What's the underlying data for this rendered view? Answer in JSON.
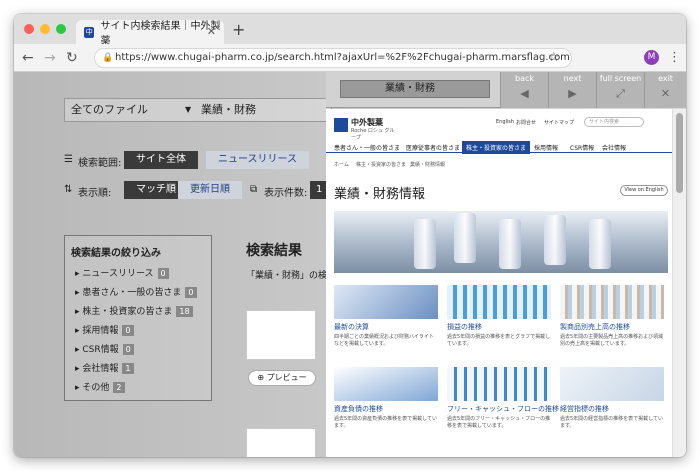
{
  "browser": {
    "tab_title": "サイト内検索結果｜中外製薬",
    "tab_favicon": "中",
    "new_tab": "+",
    "url": "https://www.chugai-pharm.co.jp/search.html?ajaxUrl=%2F%2Fchugai-pharm.marsflag.com%2Fja_all%2Fx_...",
    "profile_initial": "M"
  },
  "search_page": {
    "file_select": "全てのファイル",
    "query": "業績・財務",
    "scope_label": "検索範囲:",
    "scope_options": [
      "サイト全体",
      "ニュースリリース"
    ],
    "order_label": "表示順:",
    "order_options": [
      "マッチ順",
      "更新日順"
    ],
    "count_label": "表示件数:",
    "count_value": "1",
    "filter_title": "検索結果の絞り込み",
    "filters": [
      {
        "label": "ニュースリリース",
        "count": "0"
      },
      {
        "label": "患者さん・一般の皆さま",
        "count": "0"
      },
      {
        "label": "株主・投資家の皆さま",
        "count": "18"
      },
      {
        "label": "採用情報",
        "count": "0"
      },
      {
        "label": "CSR情報",
        "count": "0"
      },
      {
        "label": "会社情報",
        "count": "1"
      },
      {
        "label": "その他",
        "count": "2"
      }
    ],
    "results_title": "検索結果",
    "results_sub": "「業績・財務」の検",
    "preview_label": "プレビュー"
  },
  "preview_toolbar": {
    "search_text": "業績・財務",
    "buttons": [
      {
        "label": "back",
        "icon": "◀"
      },
      {
        "label": "next",
        "icon": "▶"
      },
      {
        "label": "full screen",
        "icon": "⤢"
      },
      {
        "label": "off",
        "icon": "▬"
      },
      {
        "label": "exit",
        "icon": "✕"
      }
    ]
  },
  "preview_page": {
    "logo_title": "中外製薬",
    "logo_sub": "Roche ロシュ グループ",
    "util_links": [
      "English",
      "お問合せ",
      "サイトマップ"
    ],
    "search_placeholder": "サイト内検索",
    "main_nav": [
      "患者さん・一般の皆さま",
      "医療従事者の皆さま",
      "株主・投資家の皆さま",
      "採用情報",
      "CSR情報",
      "会社情報"
    ],
    "breadcrumb": [
      "ホーム",
      "株主・投資家の皆さま",
      "業績・財務情報"
    ],
    "title": "業績・財務情報",
    "english_button": "View on English",
    "cards": [
      {
        "title": "最新の決算",
        "desc": "四半期ごとの業績概況および財務ハイライトなどを掲載しています。"
      },
      {
        "title": "損益の推移",
        "desc": "過去5年間の損益の推移を表とグラフで掲載しています。"
      },
      {
        "title": "製商品別売上高の推移",
        "desc": "過去5年間の主要製品売上高の推移および領域別の売上高を掲載しています。"
      },
      {
        "title": "資産負債の推移",
        "desc": "過去5年間の資産負債の推移を表で掲載しています。"
      },
      {
        "title": "フリー・キャッシュ・フローの推移",
        "desc": "過去5年間のフリー・キャッシュ・フローの推移を表で掲載しています。"
      },
      {
        "title": "経営指標の推移",
        "desc": "過去5年間の経営指標の推移を表で掲載しています。"
      }
    ]
  },
  "colors": {
    "brand": "#1d4b9c",
    "dot_close": "#fc5f57",
    "dot_min": "#fdbc2e",
    "dot_max": "#28c840"
  }
}
